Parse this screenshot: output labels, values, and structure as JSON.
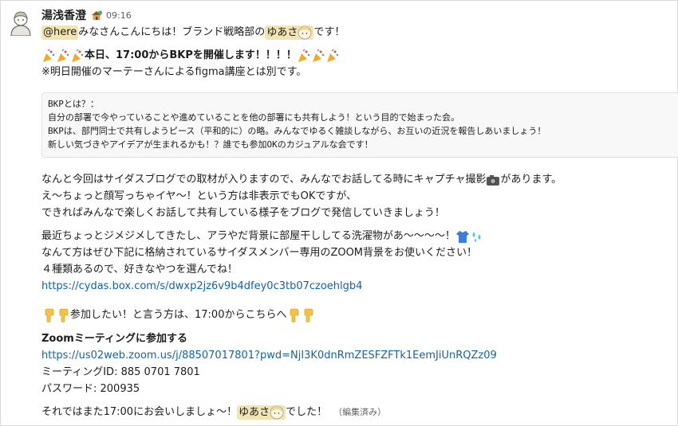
{
  "message": {
    "author": "湯浅香澄",
    "status_icon": "house-with-plant-icon",
    "time": "09:16",
    "mention_here": "@here",
    "line1_text": " みなさんこんにちは！ブランド戦略部の",
    "mention_user": "ゆあさ",
    "line1_end": "です！",
    "headline": "本日、17:00からBKPを開催します！！！！",
    "note": "※明日開催のマーテーさんによるfigma講座とは別です。",
    "quote_lines": [
      "BKPとは？：",
      "自分の部署で今やっていることや進めていることを他の部署にも共有しよう！という目的で始まった会。",
      "BKPは、部門同士で共有しようピース（平和的に）の略。みんなでゆるく雑談しながら、お互いの近況を報告しあいましょう！",
      "新しい気づきやアイデアが生まれるかも！？誰でも参加OKのカジュアルな会です！"
    ],
    "p2_line1a": "なんと今回はサイダスブログでの取材が入りますので、みんなでお話してる時にキャプチャ撮影",
    "p2_line1b": "があります。",
    "p2_line2": "え〜ちょっと顔写っちゃイヤ〜！という方は非表示でもOKですが、",
    "p2_line3": "できればみんなで楽しくお話して共有している様子をブログで発信していきましょう！",
    "p3_line1": "最近ちょっとジメジメしてきたし、アラやだ背景に部屋干ししてる洗濯物があ〜〜〜〜！",
    "p3_line2": "なんて方はぜひ下記に格納されているサイダスメンバー専用のZOOM背景をお使いください！",
    "p3_line3": "４種類あるので、好きなやつを選んでね！",
    "box_link": "https://cydas.box.com/s/dwxp2jz6v9b4dfey0c3tb07czoehlgb4",
    "join_text": "参加したい！と言う方は、17:00からこちらへ",
    "zoom_title": "Zoomミーティングに参加する",
    "zoom_link": "https://us02web.zoom.us/j/88507017801?pwd=NjI3K0dnRmZESFZFTk1EemJiUnRQZz09",
    "meeting_id": "ミーティングID: 885 0701 7801",
    "password": "パスワード: 200935",
    "closing_a": "それではまた17:00にお会いしましょ〜！",
    "closing_b": "でした！",
    "edited": "（編集済み）"
  }
}
